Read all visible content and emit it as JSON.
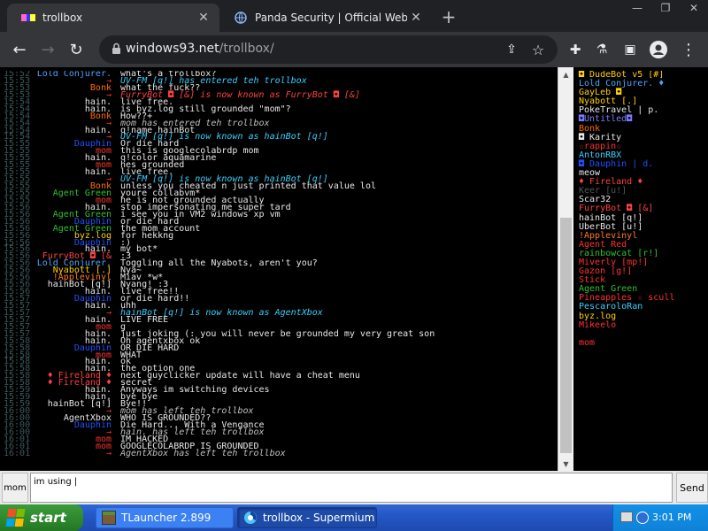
{
  "browser": {
    "tabs": [
      {
        "title": "trollbox",
        "active": true
      },
      {
        "title": "Panda Security | Official Website",
        "active": false
      }
    ],
    "url_host": "windows93.net",
    "url_path": "/trollbox/"
  },
  "chat": {
    "rows": [
      {
        "t": "15:52",
        "n": "Lold Conjurer.",
        "nc": "#4aa3ff",
        "m": "what's a trollbox?",
        "mc": "#e8e8e8"
      },
      {
        "t": "15:53",
        "n": "→",
        "nc": "#ff3030",
        "m": "UV-FM [q!] has entered teh trollbox",
        "mc": "#36d0ff",
        "sys": true
      },
      {
        "t": "15:53",
        "n": "Bonk",
        "nc": "#ff6a00",
        "m": "what the fuck??",
        "mc": "#e8e8e8"
      },
      {
        "t": "15:53",
        "n": "→",
        "nc": "#ff3030",
        "m": "FurryBot ◘ [&] is now known as FurryBot ◘ [&]",
        "mc": "#ff4040",
        "sys": true
      },
      {
        "t": "15:54",
        "n": "hain.",
        "nc": "#e8e8e8",
        "m": "live free.",
        "mc": "#e8e8e8"
      },
      {
        "t": "15:54",
        "n": "hain.",
        "nc": "#e8e8e8",
        "m": "is byz.log still grounded \"mom\"?",
        "mc": "#e8e8e8"
      },
      {
        "t": "15:54",
        "n": "Bonk",
        "nc": "#ff6a00",
        "m": "How??+",
        "mc": "#e8e8e8"
      },
      {
        "t": "15:54",
        "n": "→",
        "nc": "#ff3030",
        "m": "mom has entered teh trollbox",
        "mc": "#c0c0c0",
        "sys": true
      },
      {
        "t": "15:54",
        "n": "hain.",
        "nc": "#e8e8e8",
        "m": "q!name hainBot",
        "mc": "#e8e8e8"
      },
      {
        "t": "15:54",
        "n": "→",
        "nc": "#ff3030",
        "m": "UV-FM [q!] is now known as hainBot [q!]",
        "mc": "#36d0ff",
        "sys": true
      },
      {
        "t": "15:55",
        "n": "Dauphin",
        "nc": "#2050ff",
        "m": "Or die hard",
        "mc": "#e8e8e8"
      },
      {
        "t": "15:55",
        "n": "mom",
        "nc": "#ff3030",
        "m": "this is googlecolabrdp mom",
        "mc": "#e8e8e8"
      },
      {
        "t": "15:55",
        "n": "hain.",
        "nc": "#e8e8e8",
        "m": "q!color aquamarine",
        "mc": "#e8e8e8"
      },
      {
        "t": "15:55",
        "n": "mom",
        "nc": "#ff3030",
        "m": "hes grounded",
        "mc": "#e8e8e8"
      },
      {
        "t": "15:55",
        "n": "hain.",
        "nc": "#e8e8e8",
        "m": "live free.",
        "mc": "#e8e8e8"
      },
      {
        "t": "15:55",
        "n": "→",
        "nc": "#ff3030",
        "m": "UV-FM [q!] is now known as hainBot [q!]",
        "mc": "#36d0ff",
        "sys": true
      },
      {
        "t": "15:55",
        "n": "Bonk",
        "nc": "#ff6a00",
        "m": "unless you cheated n just printed that value lol",
        "mc": "#e8e8e8"
      },
      {
        "t": "15:55",
        "n": "Agent Green",
        "nc": "#30c030",
        "m": "youre collabvm*",
        "mc": "#e8e8e8"
      },
      {
        "t": "15:55",
        "n": "mom",
        "nc": "#ff3030",
        "m": "he is not grounded actually",
        "mc": "#e8e8e8"
      },
      {
        "t": "15:56",
        "n": "hain.",
        "nc": "#e8e8e8",
        "m": "stop impersonating me super tard",
        "mc": "#e8e8e8"
      },
      {
        "t": "15:56",
        "n": "Agent Green",
        "nc": "#30c030",
        "m": "i see you in VM2 windows xp vm",
        "mc": "#e8e8e8"
      },
      {
        "t": "15:56",
        "n": "Dauphin",
        "nc": "#2050ff",
        "m": "or die hard",
        "mc": "#e8e8e8"
      },
      {
        "t": "15:56",
        "n": "Agent Green",
        "nc": "#30c030",
        "m": "the mom account",
        "mc": "#e8e8e8"
      },
      {
        "t": "15:56",
        "n": "byz.log",
        "nc": "#ffd000",
        "m": "for hekkng",
        "mc": "#e8e8e8"
      },
      {
        "t": "15:56",
        "n": "Dauphin",
        "nc": "#2050ff",
        "m": ":)",
        "mc": "#e8e8e8"
      },
      {
        "t": "15:56",
        "n": "hain.",
        "nc": "#e8e8e8",
        "m": "my bot*",
        "mc": "#e8e8e8"
      },
      {
        "t": "15:56",
        "n": "FurryBot ◘ [&",
        "nc": "#ff4040",
        "m": ":3",
        "mc": "#e8e8e8"
      },
      {
        "t": "15:56",
        "n": "Lold Conjurer.",
        "nc": "#4aa3ff",
        "m": "Toggling all the Nyabots, aren't you?",
        "mc": "#e8e8e8"
      },
      {
        "t": "15:56",
        "n": "Nyabott [.]",
        "nc": "#ffd000",
        "m": "Nya~",
        "mc": "#e8e8e8"
      },
      {
        "t": "15:56",
        "n": "!Applevinyl",
        "nc": "#ff7a20",
        "m": "Miav *w*",
        "mc": "#e8e8e8"
      },
      {
        "t": "15:56",
        "n": "hainBot [q!]",
        "nc": "#e8e8e8",
        "m": "Nyang! :3",
        "mc": "#e8e8e8"
      },
      {
        "t": "15:56",
        "n": "hain.",
        "nc": "#e8e8e8",
        "m": "live free!!",
        "mc": "#e8e8e8"
      },
      {
        "t": "15:57",
        "n": "Dauphin",
        "nc": "#2050ff",
        "m": "or die hard!!",
        "mc": "#e8e8e8"
      },
      {
        "t": "15:57",
        "n": "hain.",
        "nc": "#e8e8e8",
        "m": "uhh",
        "mc": "#e8e8e8"
      },
      {
        "t": "15:57",
        "n": "→",
        "nc": "#ff3030",
        "m": "hainBot [q!] is now known as AgentXbox",
        "mc": "#36d0ff",
        "sys": true
      },
      {
        "t": "15:57",
        "n": "hain.",
        "nc": "#e8e8e8",
        "m": "LIVE FREE",
        "mc": "#e8e8e8"
      },
      {
        "t": "15:57",
        "n": "mom",
        "nc": "#ff3030",
        "m": "g",
        "mc": "#e8e8e8"
      },
      {
        "t": "15:57",
        "n": "hain.",
        "nc": "#e8e8e8",
        "m": "just joking (: you will never be grounded my very great son",
        "mc": "#e8e8e8"
      },
      {
        "t": "15:58",
        "n": "hain.",
        "nc": "#e8e8e8",
        "m": "Oh agentxbox ok",
        "mc": "#e8e8e8"
      },
      {
        "t": "15:58",
        "n": "Dauphin",
        "nc": "#2050ff",
        "m": "OR DIE HARD",
        "mc": "#e8e8e8"
      },
      {
        "t": "15:58",
        "n": "mom",
        "nc": "#ff3030",
        "m": "WHAT",
        "mc": "#e8e8e8"
      },
      {
        "t": "15:58",
        "n": "hain.",
        "nc": "#e8e8e8",
        "m": "ok",
        "mc": "#e8e8e8"
      },
      {
        "t": "15:58",
        "n": "hain.",
        "nc": "#e8e8e8",
        "m": "the option one",
        "mc": "#e8e8e8"
      },
      {
        "t": "15:58",
        "n": "♦ Fireland ♦",
        "nc": "#ff4040",
        "m": "next guyclicker update will have a cheat menu",
        "mc": "#e8e8e8"
      },
      {
        "t": "15:58",
        "n": "♦ Fireland ♦",
        "nc": "#ff4040",
        "m": "secret",
        "mc": "#e8e8e8"
      },
      {
        "t": "15:59",
        "n": "hain.",
        "nc": "#e8e8e8",
        "m": "Anyways im switching devices",
        "mc": "#e8e8e8"
      },
      {
        "t": "15:59",
        "n": "hain.",
        "nc": "#e8e8e8",
        "m": "bye bye",
        "mc": "#e8e8e8"
      },
      {
        "t": "15:59",
        "n": "hainBot [q!]",
        "nc": "#e8e8e8",
        "m": "Bye!!",
        "mc": "#e8e8e8"
      },
      {
        "t": "16:00",
        "n": "→",
        "nc": "#ff3030",
        "m": "mom has left teh trollbox",
        "mc": "#c0c0c0",
        "sys": true
      },
      {
        "t": "16:00",
        "n": "AgentXbox",
        "nc": "#e8e8e8",
        "m": "WHO IS GROUNDED??",
        "mc": "#e8e8e8"
      },
      {
        "t": "16:00",
        "n": "Dauphin",
        "nc": "#2050ff",
        "m": "Die Hard... With a Vengance",
        "mc": "#e8e8e8"
      },
      {
        "t": "16:00",
        "n": "→",
        "nc": "#ff3030",
        "m": "hain. has left teh trollbox",
        "mc": "#c0c0c0",
        "sys": true
      },
      {
        "t": "16:01",
        "n": "mom",
        "nc": "#ff3030",
        "m": "IM HACKED",
        "mc": "#e8e8e8"
      },
      {
        "t": "16:01",
        "n": "mom",
        "nc": "#ff3030",
        "m": "GOOGLECOLABRDP IS GROUNDED",
        "mc": "#e8e8e8"
      },
      {
        "t": "16:01",
        "n": "→",
        "nc": "#ff3030",
        "m": "AgentXbox has left teh trollbox",
        "mc": "#c0c0c0",
        "sys": true
      }
    ]
  },
  "users": [
    {
      "name": "◘ DudeBot v5 [#]",
      "color": "#ffd000"
    },
    {
      "name": "Lold Conjurer. ♦",
      "color": "#4aa3ff"
    },
    {
      "name": "GayLeb ◘",
      "color": "#ffd000"
    },
    {
      "name": "Nyabott [.]",
      "color": "#ffd000"
    },
    {
      "name": "PokeTravel | p.",
      "color": "#e8e8e8"
    },
    {
      "name": "◘Untitled◘",
      "color": "#7a7aff"
    },
    {
      "name": "Bonk",
      "color": "#ff6a00"
    },
    {
      "name": "◘ Karity",
      "color": "#e8e8e8"
    },
    {
      "name": "☆rappin☆",
      "color": "#ff3030"
    },
    {
      "name": "AntonRBX",
      "color": "#36d0ff"
    },
    {
      "name": "◘ Dauphin | d.",
      "color": "#2050ff"
    },
    {
      "name": "meow",
      "color": "#e8e8e8"
    },
    {
      "name": "♦ Fireland ♦",
      "color": "#ff4040"
    },
    {
      "name": "Keer [u!]",
      "color": "#555555"
    },
    {
      "name": "Scar32",
      "color": "#e8e8e8"
    },
    {
      "name": "FurryBot ◘ [&]",
      "color": "#ff4040"
    },
    {
      "name": "hainBot [q!]",
      "color": "#e8e8e8"
    },
    {
      "name": "UberBot [u!]",
      "color": "#e8e8e8"
    },
    {
      "name": "!Applevinyl",
      "color": "#ff7a20"
    },
    {
      "name": "Agent Red",
      "color": "#ff3030"
    },
    {
      "name": "rainbowcat [r!]",
      "color": "#30c030"
    },
    {
      "name": "Miverly [mp!]",
      "color": "#ff3030"
    },
    {
      "name": "Gazon [g!]",
      "color": "#ff3030"
    },
    {
      "name": "Stick",
      "color": "#ff3030"
    },
    {
      "name": "Agent Green",
      "color": "#30c030"
    },
    {
      "name": "Pineapples ☆ scull",
      "color": "#ff3030"
    },
    {
      "name": "PescaroloRan",
      "color": "#36d0ff"
    },
    {
      "name": "byz.log",
      "color": "#ffd000"
    },
    {
      "name": "Mikeelo",
      "color": "#ff3030"
    },
    {
      "name": "",
      "color": "#000000"
    },
    {
      "name": "mom",
      "color": "#ff3030"
    }
  ],
  "input": {
    "nick_label": "mom",
    "value": "im using |",
    "send_label": "Send"
  },
  "taskbar": {
    "start_label": "start",
    "tasks": [
      {
        "label": "TLauncher 2.899"
      },
      {
        "label": "trollbox - Supermium"
      }
    ],
    "clock": "3:01 PM"
  }
}
